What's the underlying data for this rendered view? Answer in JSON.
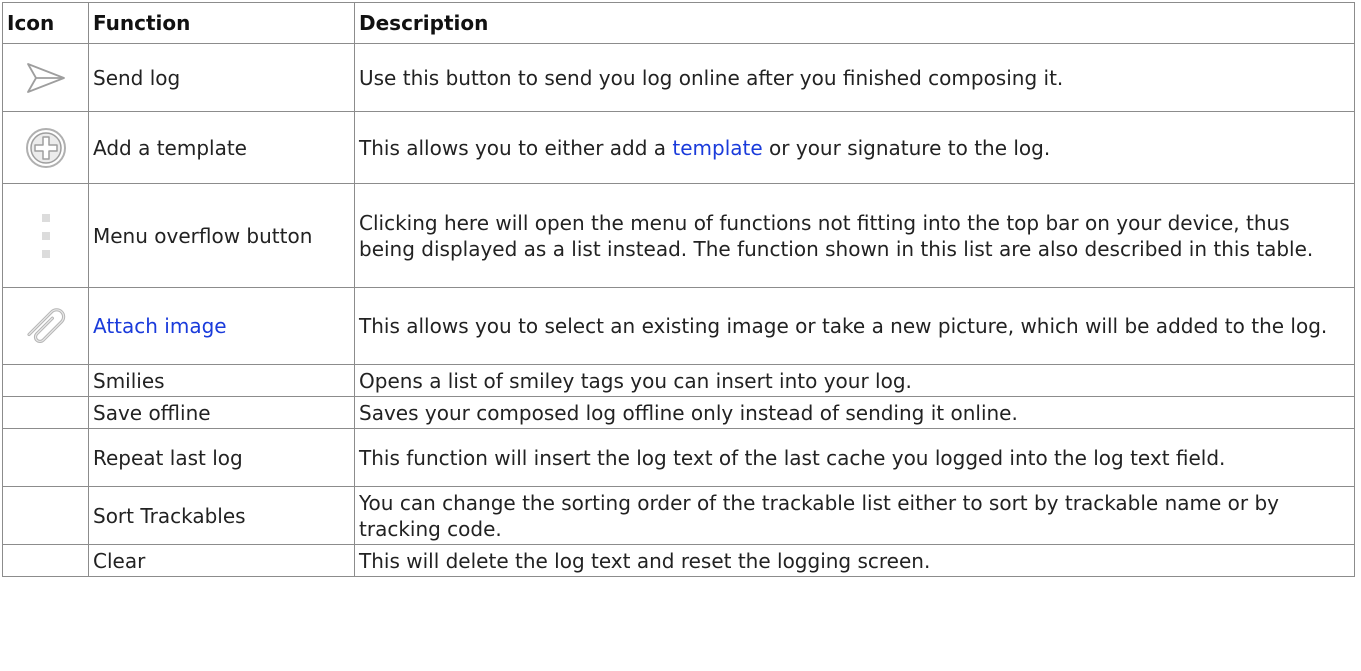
{
  "table": {
    "headers": {
      "icon": "Icon",
      "function": "Function",
      "description": "Description"
    },
    "rows": [
      {
        "icon": "send-icon",
        "function": "Send log",
        "description": "Use this button to send you log online after you finished composing it."
      },
      {
        "icon": "add-circle-icon",
        "function": "Add a template",
        "description_pre": "This allows you to either add a ",
        "description_link": "template",
        "description_post": " or your signature to the log."
      },
      {
        "icon": "overflow-menu-icon",
        "function": "Menu overflow button",
        "description": "Clicking here will open the menu of functions not fitting into the top bar on your device, thus being displayed as a list instead. The function shown in this list are also described in this table."
      },
      {
        "icon": "paperclip-icon",
        "function": "Attach image",
        "function_is_link": true,
        "description": "This allows you to select an existing image or take a new picture, which will be added to the log."
      },
      {
        "icon": "",
        "function": "Smilies",
        "description": "Opens a list of smiley tags you can insert into your log."
      },
      {
        "icon": "",
        "function": "Save offline",
        "description": "Saves your composed log offline only instead of sending it online."
      },
      {
        "icon": "",
        "function": "Repeat last log",
        "description": "This function will insert the log text of the last cache you logged into the log text field."
      },
      {
        "icon": "",
        "function": "Sort Trackables",
        "description": "You can change the sorting order of the trackable list either to sort by trackable name or by tracking code."
      },
      {
        "icon": "",
        "function": "Clear",
        "description": "This will delete the log text and reset the logging screen."
      }
    ]
  },
  "colors": {
    "link": "#1a3bdb",
    "border": "#8c8c8c",
    "icon_gray": "#9e9e9e"
  }
}
